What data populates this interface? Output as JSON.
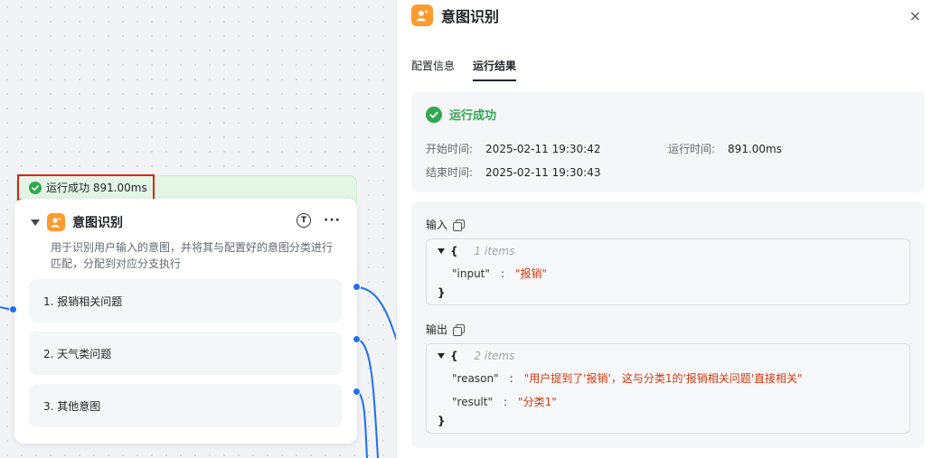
{
  "canvas": {
    "status_text": "运行成功 891.00ms",
    "node": {
      "title": "意图识别",
      "tool_icon_letter": "T",
      "more": "···",
      "description": "用于识别用户输入的意图，并将其与配置好的意图分类进行匹配，分配到对应分支执行",
      "branches": [
        "1. 报销相关问题",
        "2. 天气类问题",
        "3. 其他意图"
      ]
    }
  },
  "panel": {
    "title": "意图识别",
    "close": "×",
    "tabs": [
      {
        "label": "配置信息",
        "active": false
      },
      {
        "label": "运行结果",
        "active": true
      }
    ],
    "run": {
      "status": "运行成功",
      "start_label": "开始时间:",
      "start_value": "2025-02-11 19:30:42",
      "end_label": "结束时间:",
      "end_value": "2025-02-11 19:30:43",
      "duration_label": "运行时间:",
      "duration_value": "891.00ms"
    },
    "input": {
      "label": "输入",
      "open": "{",
      "count": "1 items",
      "entries": [
        {
          "key": "\"input\"",
          "value": "\"报销\""
        }
      ],
      "close": "}"
    },
    "output": {
      "label": "输出",
      "open": "{",
      "count": "2 items",
      "entries": [
        {
          "key": "\"reason\"",
          "value": "\"用户提到了'报销'，这与分类1的'报销相关问题'直接相关\""
        },
        {
          "key": "\"result\"",
          "value": "\"分类1\""
        }
      ],
      "close": "}"
    },
    "colors": {
      "success": "#2fa84f",
      "accent_orange": "#ff9a2e",
      "string": "#d4380d",
      "edge": "#1d6ff2"
    }
  }
}
